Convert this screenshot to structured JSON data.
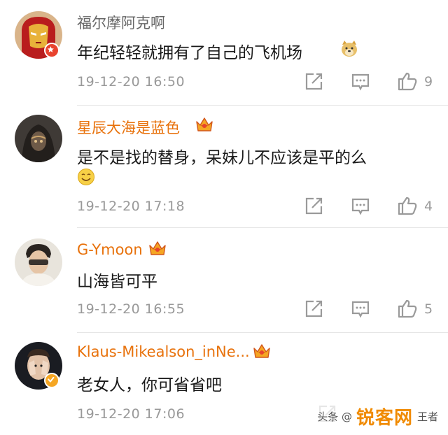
{
  "comments": [
    {
      "username": "福尔摩阿克啊",
      "text": "年纪轻轻就拥有了自己的飞机场",
      "emoji": "doge-emoji",
      "time": "19-12-20 16:50",
      "likes": "9",
      "vip": false
    },
    {
      "username": "星辰大海是蓝色",
      "text": "是不是找的替身，呆妹儿不应该是平的么",
      "emoji": "smile-emoji",
      "time": "19-12-20 17:18",
      "likes": "4",
      "vip": true
    },
    {
      "username": "G-Ymoon",
      "text": "山海皆可平",
      "time": "19-12-20 16:55",
      "likes": "5",
      "vip": true
    },
    {
      "username": "Klaus-Mikealson_inNe...",
      "text": "老女人，你可省省吧",
      "time": "19-12-20 17:06",
      "likes": "",
      "vip": true
    }
  ],
  "watermark": {
    "prefix": "头条 @",
    "logo": "锐客网",
    "suffix": "王者"
  },
  "colors": {
    "vip_name": "#e8720c",
    "plain_name": "#666666",
    "meta": "#999999",
    "crown": "#f5a623"
  }
}
